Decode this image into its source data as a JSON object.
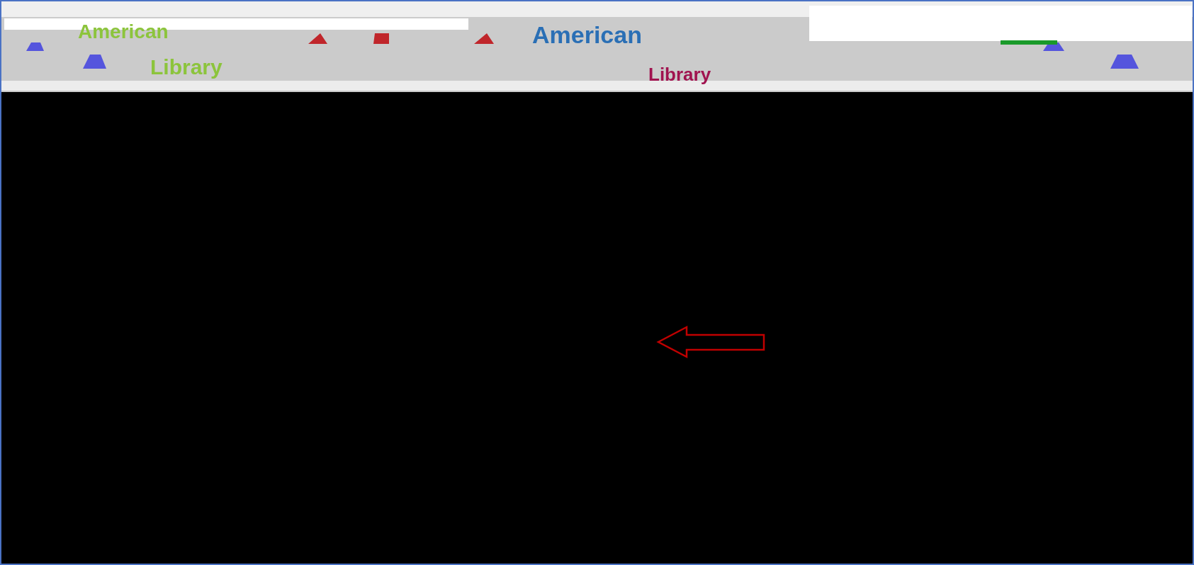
{
  "header": {
    "logo_top": "American",
    "logo_bottom": "Library",
    "title": "American",
    "subtitle": "Library"
  }
}
